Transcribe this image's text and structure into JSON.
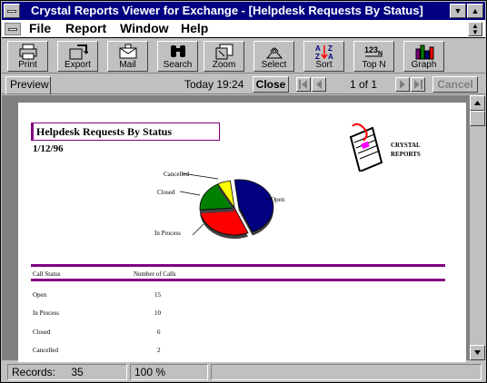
{
  "window": {
    "title": "Crystal Reports Viewer for Exchange - [Helpdesk Requests By Status]"
  },
  "menu": {
    "items": [
      {
        "label": "File"
      },
      {
        "label": "Report"
      },
      {
        "label": "Window"
      },
      {
        "label": "Help"
      }
    ]
  },
  "toolbar": {
    "buttons": [
      {
        "label": "Print",
        "icon": "printer-icon"
      },
      {
        "label": "Export",
        "icon": "export-icon"
      },
      {
        "label": "Mail",
        "icon": "mail-icon"
      },
      {
        "label": "Search",
        "icon": "binoculars-icon"
      },
      {
        "label": "Zoom",
        "icon": "zoom-icon"
      },
      {
        "label": "Select",
        "icon": "select-icon"
      },
      {
        "label": "Sort",
        "icon": "sort-icon"
      },
      {
        "label": "Top N",
        "icon": "top-n-icon"
      },
      {
        "label": "Graph",
        "icon": "graph-icon"
      }
    ]
  },
  "nav": {
    "tab": "Preview",
    "datetime": "Today 19:24",
    "close_label": "Close",
    "page_indicator": "1 of 1",
    "cancel_label": "Cancel"
  },
  "report": {
    "title": "Helpdesk Requests By Status",
    "date": "1/12/96",
    "logo_text": "CRYSTAL REPORTS",
    "columns": [
      "Call Status",
      "Number of Calls"
    ],
    "rows": [
      {
        "status": "Open",
        "count": "15"
      },
      {
        "status": "In Process",
        "count": "10"
      },
      {
        "status": "Closed",
        "count": "6"
      },
      {
        "status": "Cancelled",
        "count": "2"
      }
    ]
  },
  "chart_data": {
    "type": "pie",
    "categories": [
      "Open",
      "In Process",
      "Closed",
      "Cancelled"
    ],
    "values": [
      15,
      10,
      6,
      2
    ],
    "colors": [
      "#000080",
      "#ff0000",
      "#008000",
      "#ffff00"
    ]
  },
  "status": {
    "records_label": "Records:",
    "records_value": "35",
    "zoom": "100 %"
  }
}
